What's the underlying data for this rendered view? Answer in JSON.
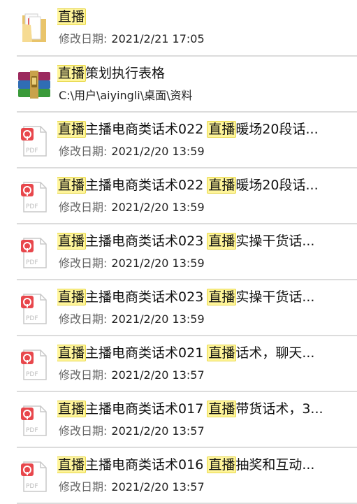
{
  "results": [
    {
      "type": "folder",
      "icon": "folder-icon",
      "highlight": "直播",
      "rest": "",
      "highlight2": "",
      "rest2": "",
      "meta_key": "修改日期:",
      "meta_val": "2021/2/21 17:05"
    },
    {
      "type": "archive",
      "icon": "winrar-archive-icon",
      "highlight": "直播",
      "rest": "策划执行表格",
      "highlight2": "",
      "rest2": "",
      "meta_key": "",
      "meta_val": "C:\\用户\\aiyingli\\桌面\\资料"
    },
    {
      "type": "pdf",
      "icon": "pdf-file-icon",
      "highlight": "直播",
      "rest": "主播电商类话术022 ",
      "highlight2": "直播",
      "rest2": "暖场20段话...",
      "meta_key": "修改日期:",
      "meta_val": "2021/2/20 13:59"
    },
    {
      "type": "pdf",
      "icon": "pdf-file-icon",
      "highlight": "直播",
      "rest": "主播电商类话术022 ",
      "highlight2": "直播",
      "rest2": "暖场20段话...",
      "meta_key": "修改日期:",
      "meta_val": "2021/2/20 13:59"
    },
    {
      "type": "pdf",
      "icon": "pdf-file-icon",
      "highlight": "直播",
      "rest": "主播电商类话术023 ",
      "highlight2": "直播",
      "rest2": "实操干货话...",
      "meta_key": "修改日期:",
      "meta_val": "2021/2/20 13:59"
    },
    {
      "type": "pdf",
      "icon": "pdf-file-icon",
      "highlight": "直播",
      "rest": "主播电商类话术023 ",
      "highlight2": "直播",
      "rest2": "实操干货话...",
      "meta_key": "修改日期:",
      "meta_val": "2021/2/20 13:59"
    },
    {
      "type": "pdf",
      "icon": "pdf-file-icon",
      "highlight": "直播",
      "rest": "主播电商类话术021 ",
      "highlight2": "直播",
      "rest2": "话术，聊天...",
      "meta_key": "修改日期:",
      "meta_val": "2021/2/20 13:57"
    },
    {
      "type": "pdf",
      "icon": "pdf-file-icon",
      "highlight": "直播",
      "rest": "主播电商类话术017 ",
      "highlight2": "直播",
      "rest2": "带货话术，3...",
      "meta_key": "修改日期:",
      "meta_val": "2021/2/20 13:57"
    },
    {
      "type": "pdf",
      "icon": "pdf-file-icon",
      "highlight": "直播",
      "rest": "主播电商类话术016 ",
      "highlight2": "直播",
      "rest2": "抽奖和互动...",
      "meta_key": "修改日期:",
      "meta_val": "2021/2/20 13:57"
    }
  ],
  "pdf_badge": "PDF",
  "colors": {
    "highlight": "#fff59a",
    "pdf_red": "#e8474c",
    "separator": "#dcdcdc"
  }
}
